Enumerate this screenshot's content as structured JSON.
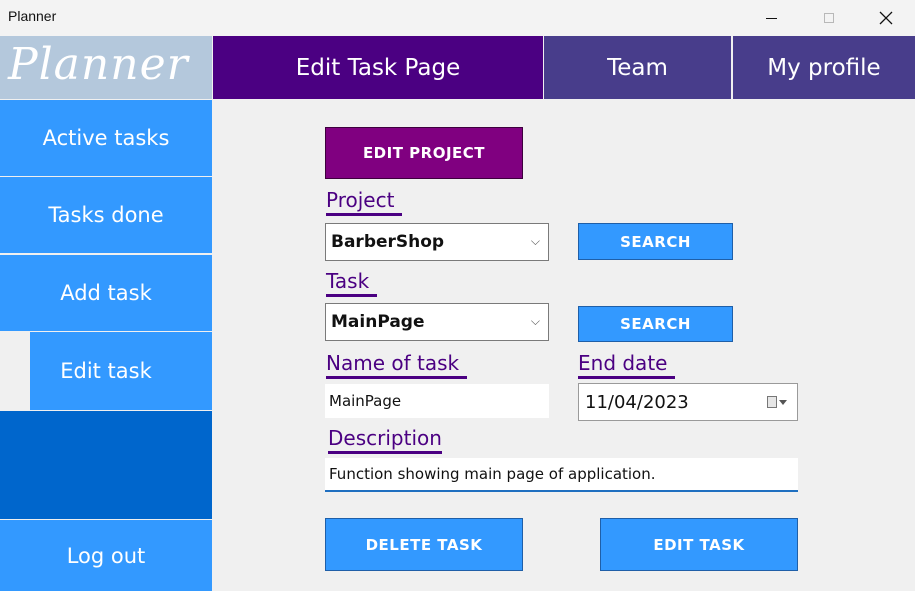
{
  "window": {
    "title": "Planner"
  },
  "header": {
    "logo": "Planner",
    "tabs": [
      {
        "label": "Edit Task Page"
      },
      {
        "label": "Team"
      },
      {
        "label": "My profile"
      }
    ]
  },
  "sidebar": {
    "items": [
      {
        "label": "Active tasks"
      },
      {
        "label": "Tasks done"
      },
      {
        "label": "Add task"
      },
      {
        "label": "Edit task"
      }
    ],
    "logout": "Log out"
  },
  "form": {
    "edit_project_button": "EDIT PROJECT",
    "project_label": "Project",
    "project_value": "BarberShop",
    "search_button": "SEARCH",
    "task_label": "Task",
    "task_value": "MainPage",
    "name_label": "Name of task",
    "name_value": "MainPage",
    "end_date_label": "End date",
    "end_date_value": "11/04/2023",
    "description_label": "Description",
    "description_value": "Function showing main page of application.",
    "delete_button": "DELETE TASK",
    "edit_button": "EDIT TASK"
  },
  "colors": {
    "accent_blue": "#3399ff",
    "dark_blue": "#0066cc",
    "header_purple": "#4b0082",
    "tab_slate": "#483d8b",
    "button_purple": "#800080",
    "logo_bg": "#b4c8dc"
  }
}
